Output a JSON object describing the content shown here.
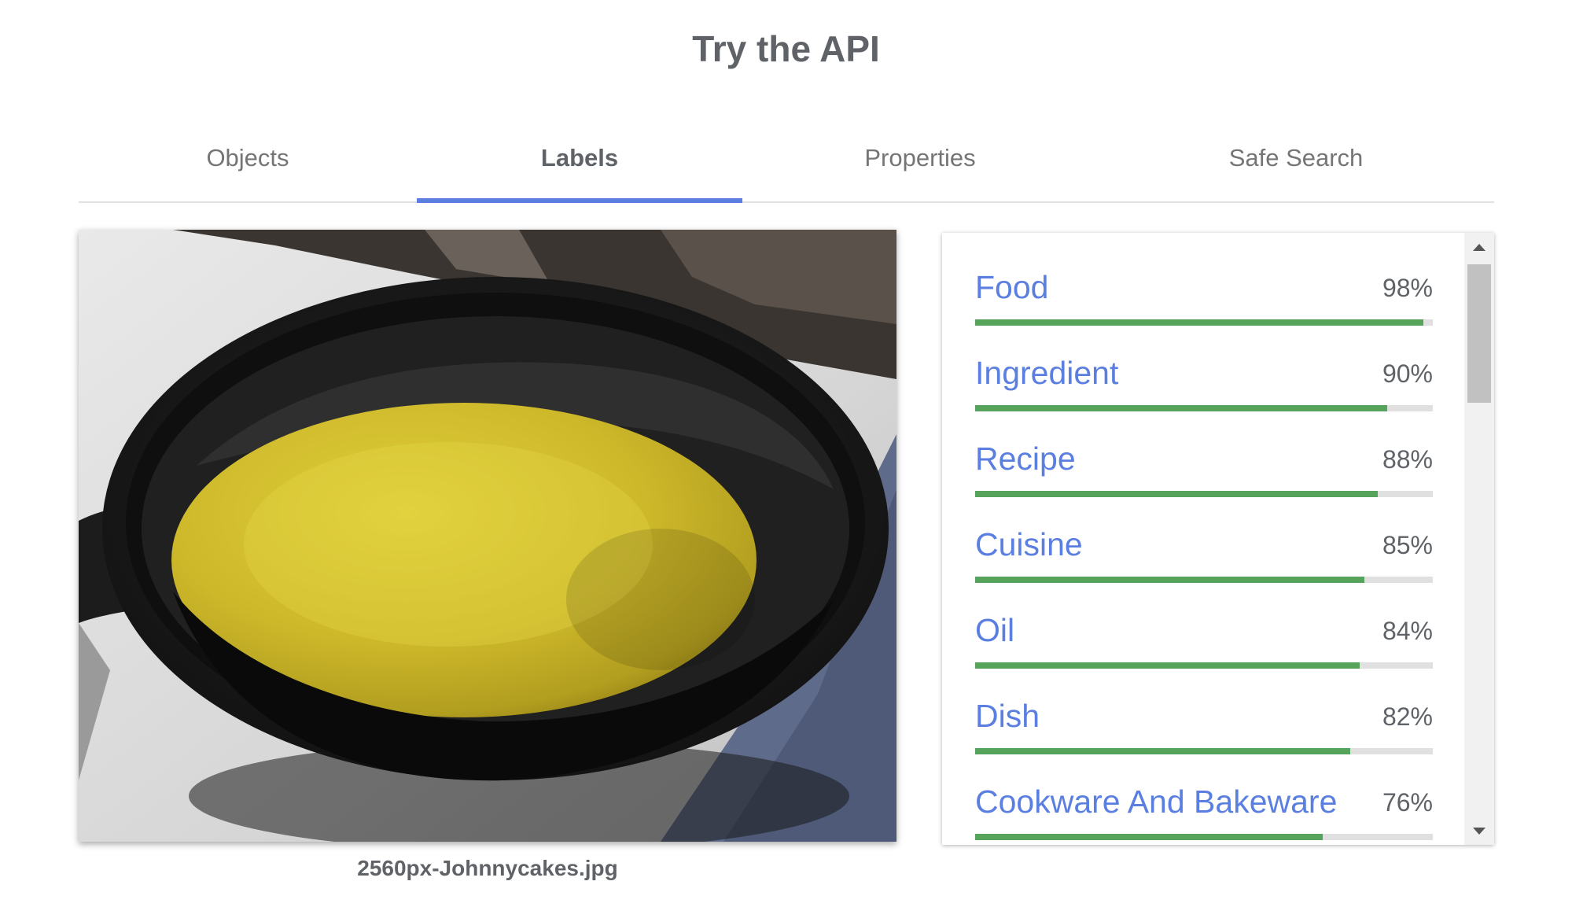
{
  "page": {
    "title": "Try the API"
  },
  "tabs": [
    {
      "label": "Objects",
      "active": false
    },
    {
      "label": "Labels",
      "active": true
    },
    {
      "label": "Properties",
      "active": false
    },
    {
      "label": "Safe Search",
      "active": false
    }
  ],
  "image": {
    "file_name": "2560px-Johnnycakes.jpg",
    "icon": "photo-icon"
  },
  "labels": [
    {
      "name": "Food",
      "score": "98%",
      "fraction": 0.98
    },
    {
      "name": "Ingredient",
      "score": "90%",
      "fraction": 0.9
    },
    {
      "name": "Recipe",
      "score": "88%",
      "fraction": 0.88
    },
    {
      "name": "Cuisine",
      "score": "85%",
      "fraction": 0.85
    },
    {
      "name": "Oil",
      "score": "84%",
      "fraction": 0.84
    },
    {
      "name": "Dish",
      "score": "82%",
      "fraction": 0.82
    },
    {
      "name": "Cookware And Bakeware",
      "score": "76%",
      "fraction": 0.76
    }
  ],
  "colors": {
    "accent": "#5b7fe0",
    "bar": "#56a35c",
    "track": "#e0e0e0",
    "text": "#5f6368"
  }
}
